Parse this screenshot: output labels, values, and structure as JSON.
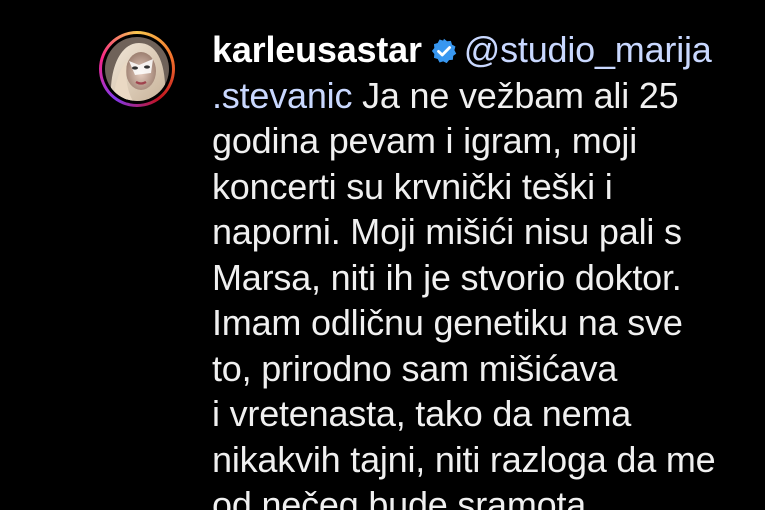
{
  "comment": {
    "avatar": {
      "icon": "profile-avatar"
    },
    "username": "karleusastar",
    "verified_icon": "verified-badge-icon",
    "mention_part1": "@studio_marija",
    "mention_part2": ".stevanic",
    "lines": [
      " Ja ne vežbam ali 25",
      "godina pevam i igram, moji",
      "koncerti su krvnički teški i",
      "naporni. Moji mišići nisu pali s",
      "Marsa, niti ih je stvorio doktor.",
      "Imam odličnu genetiku na sve",
      "to, prirodno sam mišićava",
      "i vretenasta, tako da nema",
      "nikakvih tajni, niti razloga da me",
      "od nečeg bude sramota."
    ]
  },
  "colors": {
    "background": "#000000",
    "text": "#f0f0f0",
    "mention": "#c9d8ff",
    "verified": "#3897f0"
  }
}
